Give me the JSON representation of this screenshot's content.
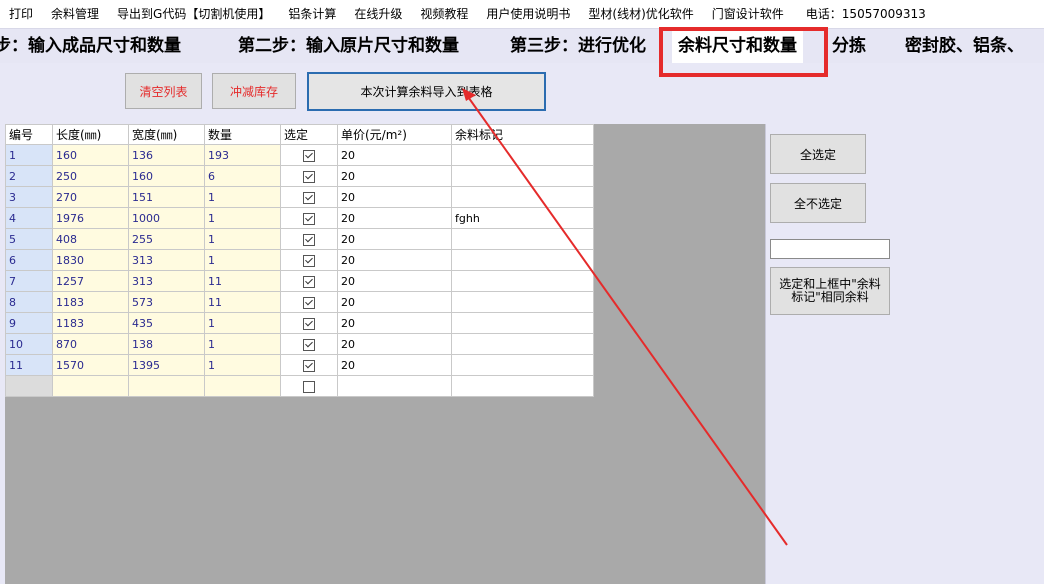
{
  "menu": {
    "items": [
      "打印",
      "余料管理",
      "导出到G代码【切割机使用】",
      "铝条计算",
      "在线升级",
      "视频教程",
      "用户使用说明书",
      "型材(线材)优化软件",
      "门窗设计软件"
    ],
    "phone": "电话：15057009313"
  },
  "tabs": [
    {
      "label": "步：输入成品尺寸和数量"
    },
    {
      "label": "第二步：输入原片尺寸和数量"
    },
    {
      "label": "第三步：进行优化"
    },
    {
      "label": "余料尺寸和数量",
      "active": true
    },
    {
      "label": "分拣"
    },
    {
      "label": "密封胶、铝条、"
    }
  ],
  "toolbar": {
    "clear_list": "清空列表",
    "deduct_stock": "冲减库存",
    "import_remnants": "本次计算余料导入到表格"
  },
  "grid": {
    "headers": [
      "编号",
      "长度(㎜)",
      "宽度(㎜)",
      "数量",
      "选定",
      "单价(元/m²)",
      "余料标记"
    ],
    "rows": [
      {
        "id": "1",
        "length": "160",
        "width": "136",
        "qty": "193",
        "checked": true,
        "price": "20",
        "mark": ""
      },
      {
        "id": "2",
        "length": "250",
        "width": "160",
        "qty": "6",
        "checked": true,
        "price": "20",
        "mark": ""
      },
      {
        "id": "3",
        "length": "270",
        "width": "151",
        "qty": "1",
        "checked": true,
        "price": "20",
        "mark": ""
      },
      {
        "id": "4",
        "length": "1976",
        "width": "1000",
        "qty": "1",
        "checked": true,
        "price": "20",
        "mark": "fghh"
      },
      {
        "id": "5",
        "length": "408",
        "width": "255",
        "qty": "1",
        "checked": true,
        "price": "20",
        "mark": ""
      },
      {
        "id": "6",
        "length": "1830",
        "width": "313",
        "qty": "1",
        "checked": true,
        "price": "20",
        "mark": ""
      },
      {
        "id": "7",
        "length": "1257",
        "width": "313",
        "qty": "11",
        "checked": true,
        "price": "20",
        "mark": ""
      },
      {
        "id": "8",
        "length": "1183",
        "width": "573",
        "qty": "11",
        "checked": true,
        "price": "20",
        "mark": ""
      },
      {
        "id": "9",
        "length": "1183",
        "width": "435",
        "qty": "1",
        "checked": true,
        "price": "20",
        "mark": ""
      },
      {
        "id": "10",
        "length": "870",
        "width": "138",
        "qty": "1",
        "checked": true,
        "price": "20",
        "mark": ""
      },
      {
        "id": "11",
        "length": "1570",
        "width": "1395",
        "qty": "1",
        "checked": true,
        "price": "20",
        "mark": ""
      }
    ]
  },
  "side": {
    "select_all": "全选定",
    "deselect_all": "全不选定",
    "mark_input_value": "",
    "select_same_mark": "选定和上框中\"余料标记\"相同余料"
  },
  "colors": {
    "highlight": "#e52b2b",
    "import_border": "#2b6cb0",
    "tab_bg": "#e6e6f4",
    "grid_bg": "#a9a9a9"
  }
}
